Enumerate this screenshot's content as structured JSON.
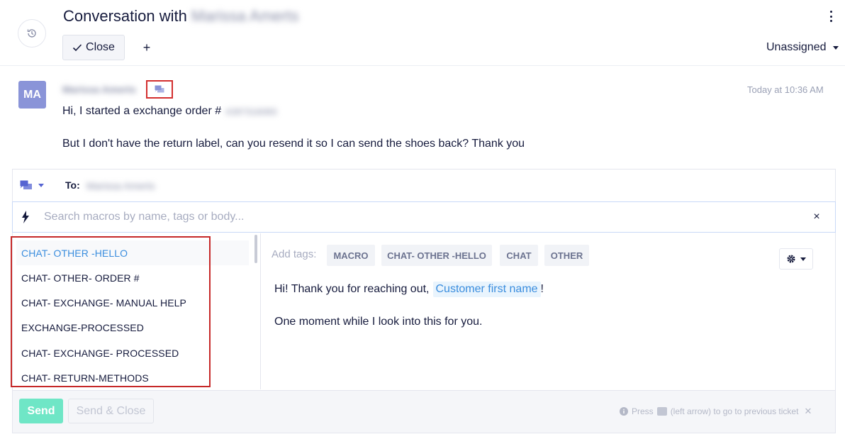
{
  "header": {
    "title_prefix": "Conversation with",
    "customer_name": "Marissa Amerts",
    "close_label": "Close",
    "add_label": "+",
    "assignee": "Unassigned"
  },
  "message": {
    "avatar_initials": "MA",
    "sender": "Marissa Amerts",
    "timestamp": "Today at 10:36 AM",
    "line1_prefix": "Hi, I started a exchange order #",
    "order_number": "#287316083",
    "line2": "But I don't have the return label, can you resend it so I can send the shoes back? Thank you"
  },
  "composer": {
    "to_label": "To:",
    "to_value": "Marissa Amerts",
    "search_placeholder": "Search macros by name, tags or body...",
    "clear_label": "×",
    "macros": [
      "CHAT- OTHER -HELLO",
      "CHAT- OTHER- ORDER #",
      "CHAT- EXCHANGE- MANUAL HELP",
      "EXCHANGE-PROCESSED",
      "CHAT- EXCHANGE- PROCESSED",
      "CHAT- RETURN-METHODS"
    ],
    "selected_macro_index": 0,
    "preview": {
      "tags_label": "Add tags:",
      "tags": [
        "MACRO",
        "CHAT- OTHER -HELLO",
        "CHAT",
        "OTHER"
      ],
      "line1_prefix": "Hi! Thank you for reaching out,",
      "variable": "Customer first name",
      "line1_suffix": "!",
      "line2": "One moment while I look into this for you."
    }
  },
  "footer": {
    "send_label": "Send",
    "send_close_label": "Send & Close",
    "hint_prefix": "Press",
    "hint_suffix": "(left arrow) to go to previous ticket",
    "hint_close": "✕"
  },
  "colors": {
    "accent": "#3a8dde",
    "send": "#6fe6c6",
    "highlight": "#c62828",
    "avatar": "#8a94d8"
  },
  "icons": {
    "history": "history-icon",
    "more": "kebab-icon",
    "check": "check-icon",
    "chat": "chat-bubbles-icon",
    "bolt": "lightning-icon",
    "gear": "gear-icon",
    "info": "info-icon"
  }
}
